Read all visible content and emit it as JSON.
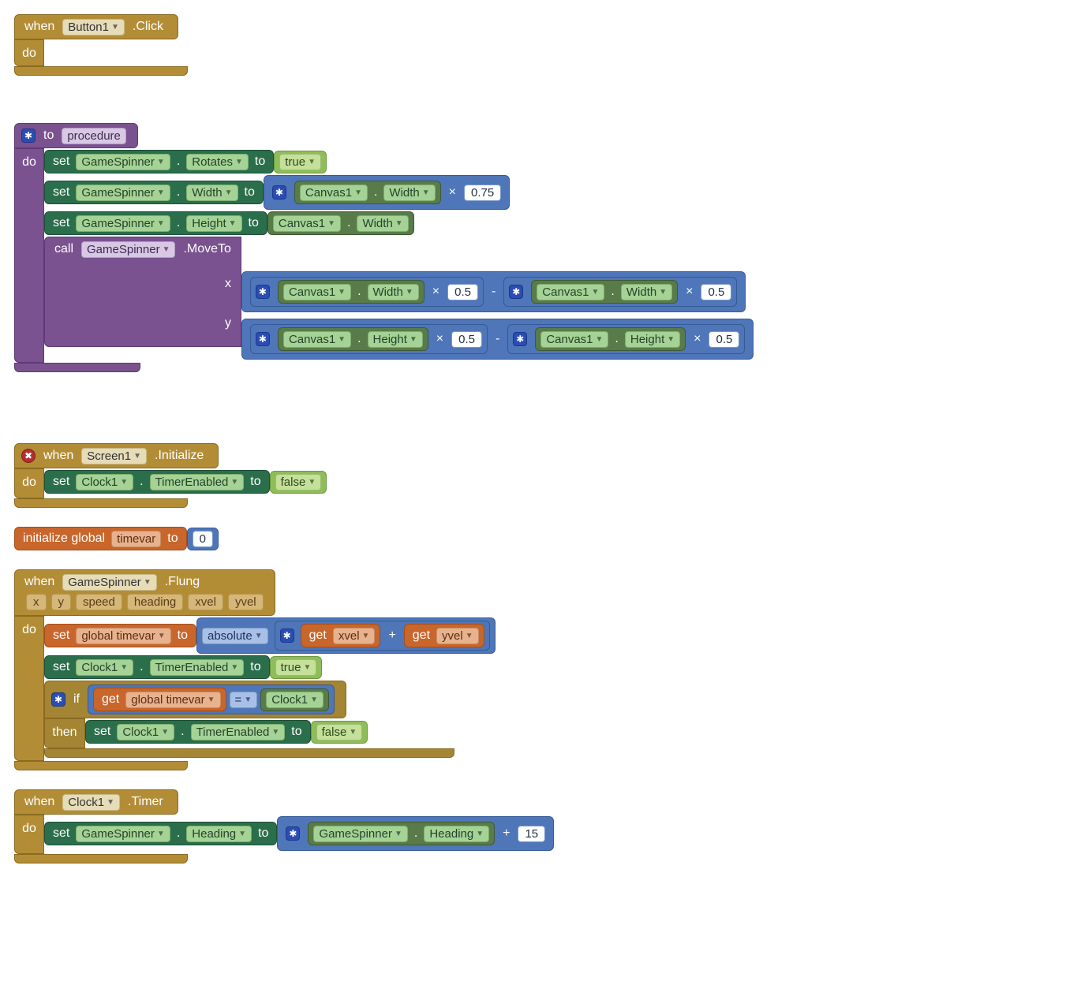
{
  "kw": {
    "when": "when",
    "do": "do",
    "to_proc": "to",
    "set": "set",
    "to": "to",
    "call": "call",
    "if": "if",
    "then": "then",
    "initialize_global": "initialize global",
    "get": "get",
    "absolute": "absolute"
  },
  "components": {
    "button1": "Button1",
    "screen1": "Screen1",
    "gamespinner": "GameSpinner",
    "canvas1": "Canvas1",
    "clock1": "Clock1"
  },
  "events": {
    "click": ".Click",
    "initialize": ".Initialize",
    "flung": ".Flung",
    "timer": ".Timer"
  },
  "props": {
    "rotates": "Rotates",
    "width": "Width",
    "height": "Height",
    "moveto": ".MoveTo",
    "timerenabled": "TimerEnabled",
    "heading": "Heading"
  },
  "args": {
    "x": "x",
    "y": "y"
  },
  "params": {
    "x": "x",
    "y": "y",
    "speed": "speed",
    "heading": "heading",
    "xvel": "xvel",
    "yvel": "yvel"
  },
  "vars": {
    "timevar": "timevar",
    "global_timevar": "global timevar"
  },
  "vals": {
    "true": "true",
    "false": "false",
    "zero": "0",
    "p75": "0.75",
    "p5a": "0.5",
    "p5b": "0.5",
    "p5c": "0.5",
    "p5d": "0.5",
    "fifteen": "15"
  },
  "ops": {
    "mul": "×",
    "plus": "+",
    "minus": "-",
    "eq": "="
  },
  "sep": {
    "dot": "."
  }
}
